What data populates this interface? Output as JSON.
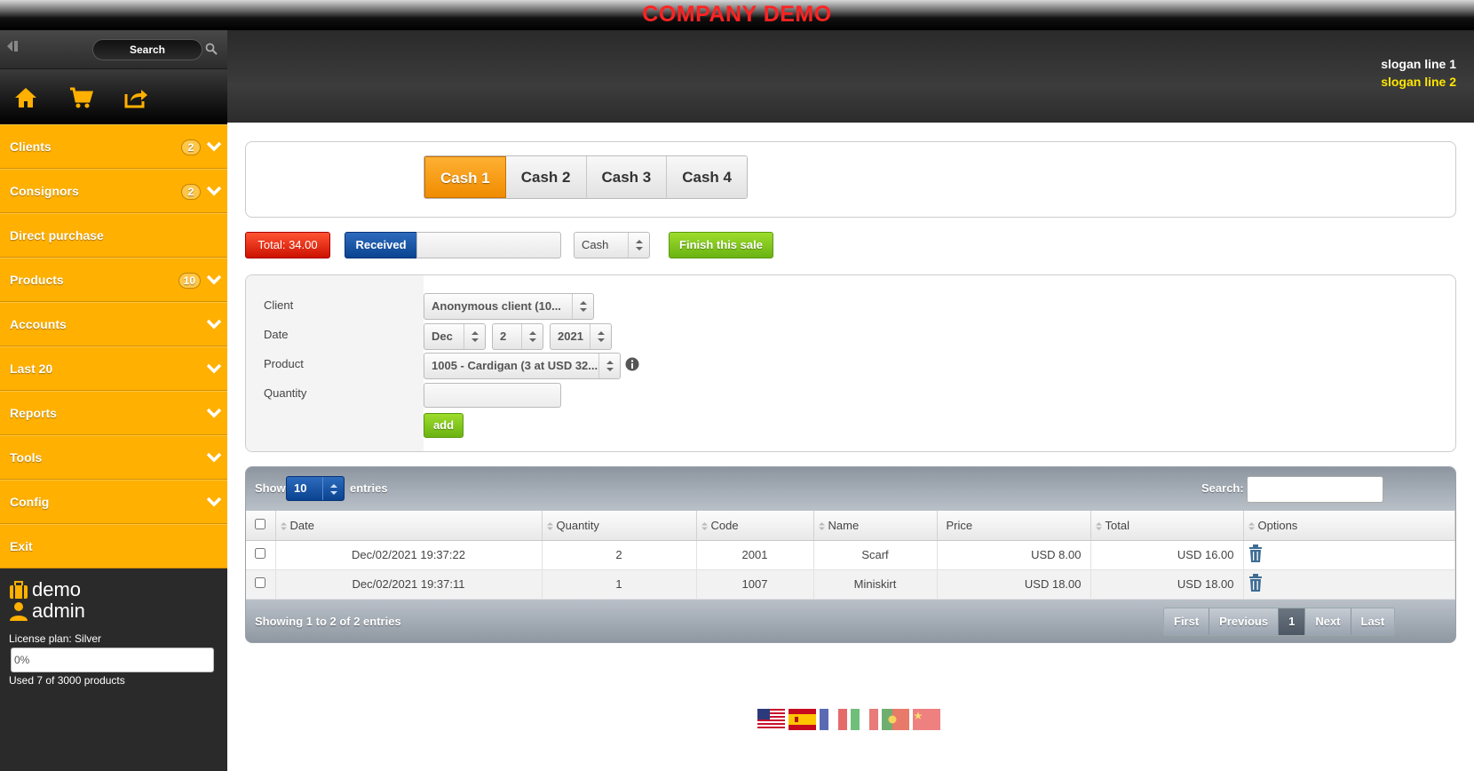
{
  "company": "COMPANY DEMO",
  "sidebar": {
    "search_label": "Search",
    "menu": [
      {
        "label": "Clients",
        "badge": "2",
        "chevron": true
      },
      {
        "label": "Consignors",
        "badge": "2",
        "chevron": true
      },
      {
        "label": "Direct purchase",
        "badge": "",
        "chevron": false
      },
      {
        "label": "Products",
        "badge": "10",
        "chevron": true
      },
      {
        "label": "Accounts",
        "badge": "",
        "chevron": true
      },
      {
        "label": "Last 20",
        "badge": "",
        "chevron": true
      },
      {
        "label": "Reports",
        "badge": "",
        "chevron": true
      },
      {
        "label": "Tools",
        "badge": "",
        "chevron": true
      },
      {
        "label": "Config",
        "badge": "",
        "chevron": true
      },
      {
        "label": "Exit",
        "badge": "",
        "chevron": false
      }
    ],
    "user": {
      "company": "demo",
      "name": "admin"
    },
    "license": "License plan: Silver",
    "progress_text": "0%",
    "progress_fraction": 0.0,
    "used": "Used 7 of 3000 products"
  },
  "header": {
    "slogan1": "slogan line 1",
    "slogan2": "slogan line 2"
  },
  "cash_tabs": [
    {
      "label": "Cash 1",
      "active": true
    },
    {
      "label": "Cash 2",
      "active": false
    },
    {
      "label": "Cash 3",
      "active": false
    },
    {
      "label": "Cash 4",
      "active": false
    }
  ],
  "sale": {
    "total": "Total: 34.00",
    "received_label": "Received",
    "received_value": "",
    "payment_method": "Cash",
    "finish_label": "Finish this sale"
  },
  "form": {
    "client_label": "Client",
    "client_value": "Anonymous client (10...",
    "date_label": "Date",
    "date_month": "Dec",
    "date_day": "2",
    "date_year": "2021",
    "product_label": "Product",
    "product_value": "1005 - Cardigan (3 at USD 32...",
    "quantity_label": "Quantity",
    "quantity_value": "",
    "add_label": "add"
  },
  "table": {
    "show_label": "Show",
    "show_value": "10",
    "entries_label": "entries",
    "search_label": "Search:",
    "headers": [
      "Date",
      "Quantity",
      "Code",
      "Name",
      "Price",
      "Total",
      "Options"
    ],
    "rows": [
      {
        "date": "Dec/02/2021 19:37:22",
        "quantity": "2",
        "code": "2001",
        "name": "Scarf",
        "price": "USD 8.00",
        "total": "USD 16.00"
      },
      {
        "date": "Dec/02/2021 19:37:11",
        "quantity": "1",
        "code": "1007",
        "name": "Miniskirt",
        "price": "USD 18.00",
        "total": "USD 18.00"
      }
    ],
    "showing": "Showing 1 to 2 of 2 entries",
    "pager": [
      "First",
      "Previous",
      "1",
      "Next",
      "Last"
    ]
  },
  "colors": {
    "accent": "#ffb000",
    "brand_red": "#ff2222",
    "slogan_yellow": "#ffe600"
  },
  "flags": [
    "us-flag-icon",
    "es-flag-icon",
    "fr-flag-icon",
    "it-flag-icon",
    "pt-flag-icon",
    "cn-flag-icon"
  ]
}
